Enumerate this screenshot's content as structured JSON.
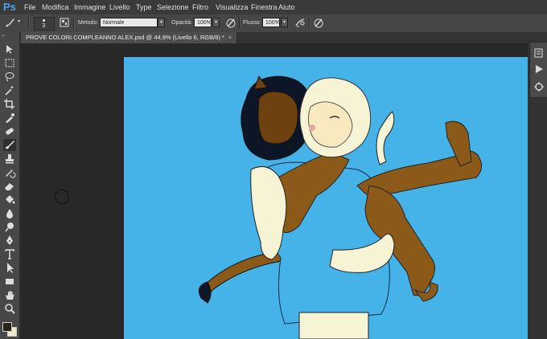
{
  "app": {
    "logo": "Ps"
  },
  "menu": [
    "File",
    "Modifica",
    "Immagine",
    "Livello",
    "Type",
    "Selezione",
    "Filtro",
    "Visualizza",
    "Finestra",
    "Aiuto"
  ],
  "options": {
    "brush_size": "3",
    "metodo_label": "Metodo:",
    "metodo_value": "Normale",
    "opacita_label": "Opacità:",
    "opacita_value": "100%",
    "flusso_label": "Flusso:",
    "flusso_value": "100%"
  },
  "document": {
    "tab_title": "PROVE COLORI COMPLEANNO ALEX.psd @ 44,9% (Livello 6, RGB/8) *",
    "close_glyph": "×"
  },
  "colors": {
    "canvas_bg": "#45b3e8",
    "foreground": "#2a2418",
    "background": "#f3e7c9",
    "ps_blue": "#4fa3e8"
  },
  "tools": [
    "move-tool",
    "marquee-tool",
    "lasso-tool",
    "magic-wand-tool",
    "crop-tool",
    "eyedropper-tool",
    "healing-brush-tool",
    "brush-tool",
    "clone-stamp-tool",
    "history-brush-tool",
    "eraser-tool",
    "paint-bucket-tool",
    "blur-tool",
    "dodge-tool",
    "pen-tool",
    "type-tool",
    "path-selection-tool",
    "rectangle-tool",
    "hand-tool",
    "zoom-tool"
  ],
  "active_tool": "brush-tool",
  "right_panel_icons": [
    "history-icon",
    "actions-play-icon",
    "brush-presets-icon"
  ]
}
